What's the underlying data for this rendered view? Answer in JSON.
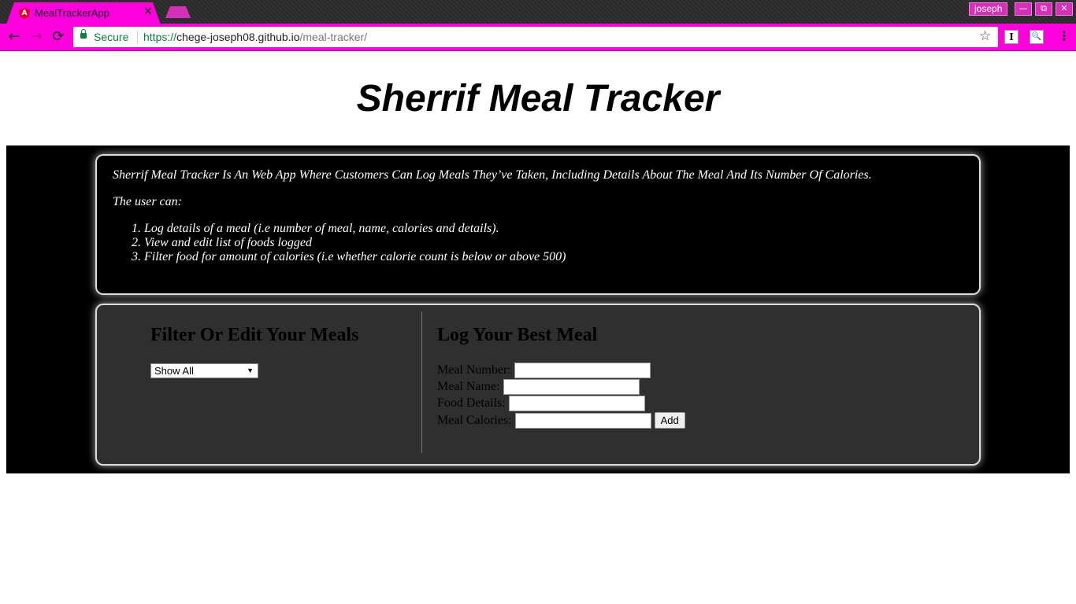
{
  "browser": {
    "tab_title": "MealTrackerApp",
    "tab_close": "✕",
    "profile_name": "joseph",
    "window_minimize": "—",
    "window_restore": "⧉",
    "window_close": "✕",
    "back": "←",
    "forward": "→",
    "reload": "⟳",
    "security_label": "Secure",
    "url_scheme": "https://",
    "url_host": "chege-joseph08.github.io",
    "url_path": "/meal-tracker/",
    "star": "☆",
    "ext1": "I",
    "ext2": "🔍",
    "menu": "⋮",
    "favicon": "A"
  },
  "page": {
    "title": "Sherrif Meal Tracker",
    "intro": {
      "description": "Sherrif Meal Tracker Is An Web App Where Customers Can Log Meals They’ve Taken, Including Details About The Meal And Its Number Of Calories.",
      "user_can": "The user can:",
      "features": [
        "Log details of a meal (i.e number of meal, name, calories and details).",
        "View and edit list of foods logged",
        "Filter food for amount of calories (i.e whether calorie count is below or above 500)"
      ]
    },
    "filter": {
      "heading": "Filter Or Edit Your Meals",
      "selected": "Show All",
      "caret": "▼"
    },
    "log": {
      "heading": "Log Your Best Meal",
      "meal_number_label": "Meal Number:",
      "meal_name_label": "Meal Name:",
      "food_details_label": "Food Details:",
      "meal_calories_label": "Meal Calories:",
      "meal_number_value": "",
      "meal_name_value": "",
      "food_details_value": "",
      "meal_calories_value": "",
      "add_button": "Add"
    }
  }
}
